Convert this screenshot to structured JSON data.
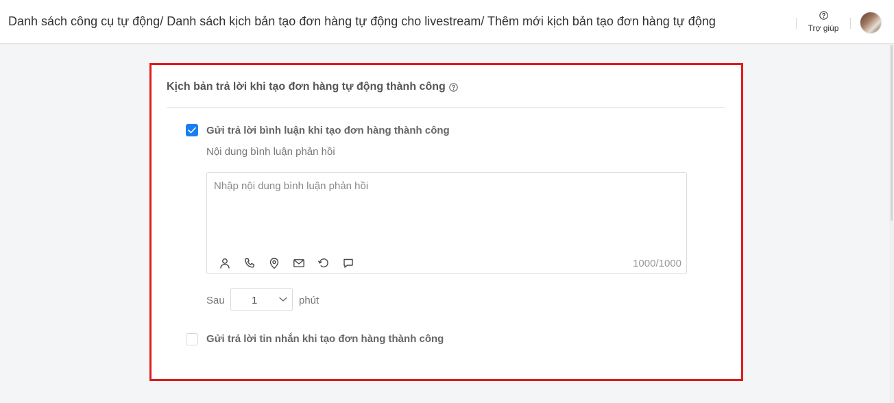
{
  "header": {
    "breadcrumb": "Danh sách công cụ tự động/ Danh sách kịch bản tạo đơn hàng tự động cho livestream/ Thêm mới kịch bản tạo đơn hàng tự động",
    "help_label": "Trợ giúp",
    "help_icon": "question-circle-icon"
  },
  "section": {
    "title": "Kịch bản trả lời khi tạo đơn hàng tự động thành công",
    "title_icon": "question-circle-icon",
    "comment_reply": {
      "checked": true,
      "label": "Gửi trả lời bình luận khi tạo đơn hàng thành công",
      "content_label": "Nội dung bình luận phản hồi",
      "placeholder": "Nhập nội dung bình luận phản hồi",
      "value": "",
      "counter": "1000/1000",
      "toolbar_icons": [
        "user-icon",
        "phone-icon",
        "location-pin-icon",
        "mail-icon",
        "history-icon",
        "chat-bubble-icon"
      ]
    },
    "delay": {
      "prefix": "Sau",
      "value": "1",
      "suffix": "phút"
    },
    "message_reply": {
      "checked": false,
      "label": "Gửi trả lời tin nhắn khi tạo đơn hàng thành công"
    }
  },
  "colors": {
    "accent": "#1a7ef2",
    "highlight_border": "#e01b1b"
  }
}
